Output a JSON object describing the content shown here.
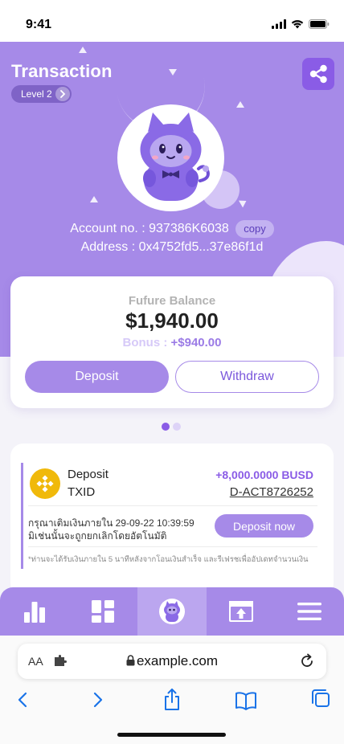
{
  "status_bar": {
    "time": "9:41"
  },
  "header": {
    "title": "Transaction",
    "level": "Level 2"
  },
  "account": {
    "account_label": "Account no. :",
    "account_number": "937386K6038",
    "copy_label": "copy",
    "address_label": "Address :",
    "address_value": "0x4752fd5...37e86f1d"
  },
  "balance": {
    "label": "Fufure Balance",
    "amount": "$1,940.00",
    "bonus_label": "Bonus :",
    "bonus_value": "+$940.00",
    "deposit_label": "Deposit",
    "withdraw_label": "Withdraw"
  },
  "carousel": {
    "active_index": 0,
    "count": 2
  },
  "transaction": {
    "type": "Deposit",
    "txid_label": "TXID",
    "amount": "+8,000.0000 BUSD",
    "reference": "D-ACT8726252",
    "note_line1": "กรุณาเติมเงินภายใน 29-09-22 10:39:59",
    "note_line2": "มิเช่นนั้นจะถูกยกเลิกโดยอัตโนมัติ",
    "action_label": "Deposit now",
    "footnote": "*ท่านจะได้รับเงินภายใน 5 นาทีหลังจากโอนเงินสำเร็จ และรีเฟรชเพื่ออัปเดทจำนวนเงิน"
  },
  "bottom_nav": {
    "items": [
      {
        "icon": "bar-chart-icon",
        "active": false
      },
      {
        "icon": "dashboard-grid-icon",
        "active": false
      },
      {
        "icon": "mascot-icon",
        "active": true
      },
      {
        "icon": "upload-tray-icon",
        "active": false
      },
      {
        "icon": "menu-icon",
        "active": false
      }
    ]
  },
  "browser": {
    "text_size_label": "AA",
    "url": "example.com"
  },
  "colors": {
    "primary": "#a68ae8",
    "accent": "#8a5ce6",
    "coin": "#f0b90b"
  }
}
